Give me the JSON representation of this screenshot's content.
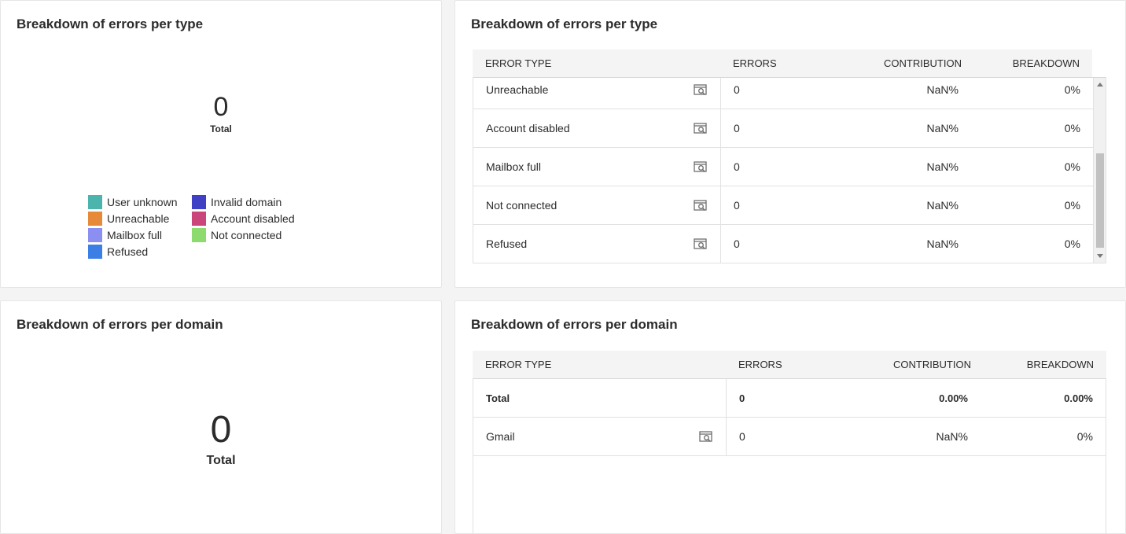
{
  "type_chart": {
    "title": "Breakdown of errors per type",
    "total_value": "0",
    "total_label": "Total",
    "legend": [
      {
        "label": "User unknown",
        "color": "#4bb5ad"
      },
      {
        "label": "Invalid domain",
        "color": "#3f40c4"
      },
      {
        "label": "Unreachable",
        "color": "#e68a3a"
      },
      {
        "label": "Account disabled",
        "color": "#c9457a"
      },
      {
        "label": "Mailbox full",
        "color": "#8b8ff1"
      },
      {
        "label": "Not connected",
        "color": "#8ddb6f"
      },
      {
        "label": "Refused",
        "color": "#3b7fe6"
      }
    ]
  },
  "type_table": {
    "title": "Breakdown of errors per type",
    "headers": {
      "type": "ERROR TYPE",
      "errors": "ERRORS",
      "contribution": "CONTRIBUTION",
      "breakdown": "BREAKDOWN"
    },
    "rows": [
      {
        "type": "Unreachable",
        "errors": "0",
        "contribution": "NaN%",
        "breakdown": "0%"
      },
      {
        "type": "Account disabled",
        "errors": "0",
        "contribution": "NaN%",
        "breakdown": "0%"
      },
      {
        "type": "Mailbox full",
        "errors": "0",
        "contribution": "NaN%",
        "breakdown": "0%"
      },
      {
        "type": "Not connected",
        "errors": "0",
        "contribution": "NaN%",
        "breakdown": "0%"
      },
      {
        "type": "Refused",
        "errors": "0",
        "contribution": "NaN%",
        "breakdown": "0%"
      }
    ]
  },
  "domain_chart": {
    "title": "Breakdown of errors per domain",
    "total_value": "0",
    "total_label": "Total"
  },
  "domain_table": {
    "title": "Breakdown of errors per domain",
    "headers": {
      "type": "ERROR TYPE",
      "errors": "ERRORS",
      "contribution": "CONTRIBUTION",
      "breakdown": "BREAKDOWN"
    },
    "total_row": {
      "type": "Total",
      "errors": "0",
      "contribution": "0.00%",
      "breakdown": "0.00%"
    },
    "rows": [
      {
        "type": "Gmail",
        "errors": "0",
        "contribution": "NaN%",
        "breakdown": "0%"
      }
    ]
  }
}
